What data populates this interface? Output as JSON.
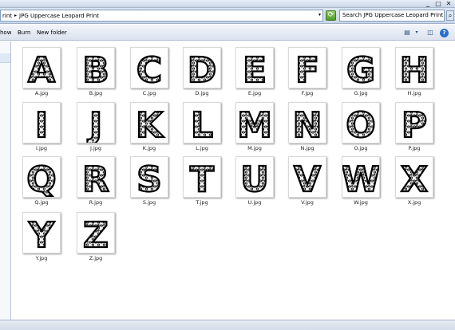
{
  "window": {
    "minimize_label": "_",
    "maximize_label": "□",
    "close_label": "✕"
  },
  "address": {
    "part1": "rint",
    "part2": "JPG Uppercase Leopard Print",
    "search_placeholder": "Search JPG Uppercase Leopard Print"
  },
  "toolbar": {
    "show_label": "how",
    "burn_label": "Burn",
    "new_folder_label": "New folder"
  },
  "files": [
    {
      "letter": "A",
      "name": "A.jpg"
    },
    {
      "letter": "B",
      "name": "B.jpg"
    },
    {
      "letter": "C",
      "name": "C.jpg"
    },
    {
      "letter": "D",
      "name": "D.jpg"
    },
    {
      "letter": "E",
      "name": "E.jpg"
    },
    {
      "letter": "F",
      "name": "F.jpg"
    },
    {
      "letter": "G",
      "name": "G.jpg"
    },
    {
      "letter": "H",
      "name": "H.jpg"
    },
    {
      "letter": "I",
      "name": "I.jpg"
    },
    {
      "letter": "J",
      "name": "J.jpg"
    },
    {
      "letter": "K",
      "name": "K.jpg"
    },
    {
      "letter": "L",
      "name": "L.jpg"
    },
    {
      "letter": "M",
      "name": "M.jpg"
    },
    {
      "letter": "N",
      "name": "N.jpg"
    },
    {
      "letter": "O",
      "name": "O.jpg"
    },
    {
      "letter": "P",
      "name": "P.jpg"
    },
    {
      "letter": "Q",
      "name": "Q.jpg"
    },
    {
      "letter": "R",
      "name": "R.jpg"
    },
    {
      "letter": "S",
      "name": "S.jpg"
    },
    {
      "letter": "T",
      "name": "T.jpg"
    },
    {
      "letter": "U",
      "name": "U.jpg"
    },
    {
      "letter": "V",
      "name": "V.jpg"
    },
    {
      "letter": "W",
      "name": "W.jpg"
    },
    {
      "letter": "X",
      "name": "X.jpg"
    },
    {
      "letter": "Y",
      "name": "Y.jpg"
    },
    {
      "letter": "Z",
      "name": "Z.jpg"
    }
  ]
}
